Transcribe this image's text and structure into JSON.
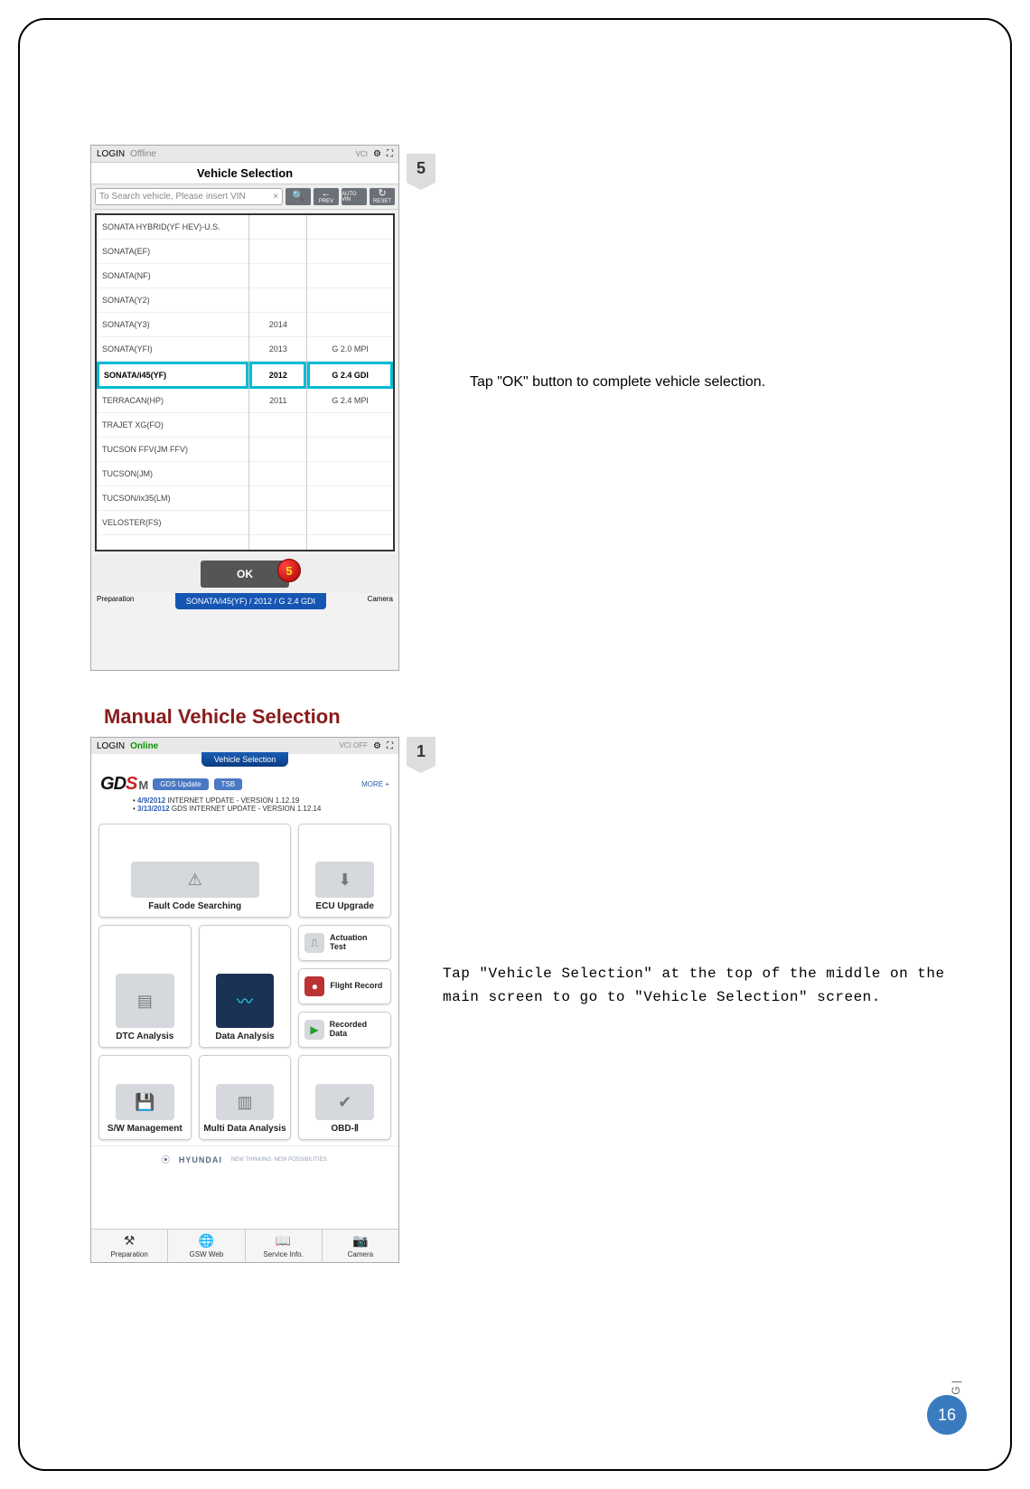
{
  "page": {
    "number": "16",
    "side_label": "G |"
  },
  "step5": {
    "badge": "5",
    "instruction": "Tap \"OK\" button to complete vehicle selection."
  },
  "step1": {
    "badge": "1",
    "instruction": "Tap \"Vehicle Selection\" at the top of the middle on the main screen to go to \"Vehicle Selection\" screen."
  },
  "section_title": "Manual Vehicle Selection",
  "shot1": {
    "login": "LOGIN",
    "status": "Offline",
    "vci": "VCI",
    "title": "Vehicle Selection",
    "search_placeholder": "To Search vehicle, Please insert VIN",
    "clear": "×",
    "btn_search": "🔍",
    "btn_prev": "PREV",
    "btn_prev_icon": "←",
    "btn_autovin": "AUTO VIN",
    "btn_reset": "RESET",
    "btn_reset_icon": "↻",
    "col1": [
      "SONATA HYBRID(YF HEV)-U.S.",
      "SONATA(EF)",
      "SONATA(NF)",
      "SONATA(Y2)",
      "SONATA(Y3)",
      "SONATA(YFI)",
      "SONATA/i45(YF)",
      "TERRACAN(HP)",
      "TRAJET XG(FO)",
      "TUCSON FFV(JM FFV)",
      "TUCSON(JM)",
      "TUCSON/ix35(LM)",
      "VELOSTER(FS)"
    ],
    "col2": [
      "",
      "",
      "",
      "",
      "2014",
      "2013",
      "2012",
      "2011",
      "",
      "",
      "",
      "",
      ""
    ],
    "col3": [
      "",
      "",
      "",
      "",
      "",
      "G 2.0 MPI",
      "G 2.4 GDI",
      "G 2.4 MPI",
      "",
      "",
      "",
      "",
      ""
    ],
    "selected_index": 6,
    "ok": "OK",
    "callout": "5",
    "selected_bar": "SONATA/i45(YF) / 2012 / G 2.4 GDI",
    "bottom_left": "Preparation",
    "bottom_right": "Camera"
  },
  "shot2": {
    "login": "LOGIN",
    "status": "Online",
    "vci": "VCI",
    "vci_off": "OFF",
    "tab": "Vehicle Selection",
    "logo": {
      "text_g": "G",
      "text_d": "D",
      "text_s": "S",
      "text_m": "M"
    },
    "pill_gds": "GDS Update",
    "pill_tsb": "TSB",
    "more": "MORE +",
    "updates": [
      {
        "date": "4/9/2012",
        "text": "INTERNET UPDATE - VERSION 1.12.19"
      },
      {
        "date": "3/13/2012",
        "text": "GDS INTERNET UPDATE - VERSION 1.12.14"
      }
    ],
    "tiles": {
      "fault": "Fault Code Searching",
      "ecu": "ECU Upgrade",
      "dtc": "DTC Analysis",
      "data": "Data Analysis",
      "actuation": "Actuation Test",
      "flight": "Flight Record",
      "recorded": "Recorded Data",
      "sw": "S/W Management",
      "multi": "Multi Data Analysis",
      "obd": "OBD-Ⅱ"
    },
    "brand": "HYUNDAI",
    "brand_tag": "NEW THINKING. NEW POSSIBILITIES.",
    "nav": {
      "prep": "Preparation",
      "gsw": "GSW Web",
      "service": "Service Info.",
      "camera": "Camera"
    }
  }
}
